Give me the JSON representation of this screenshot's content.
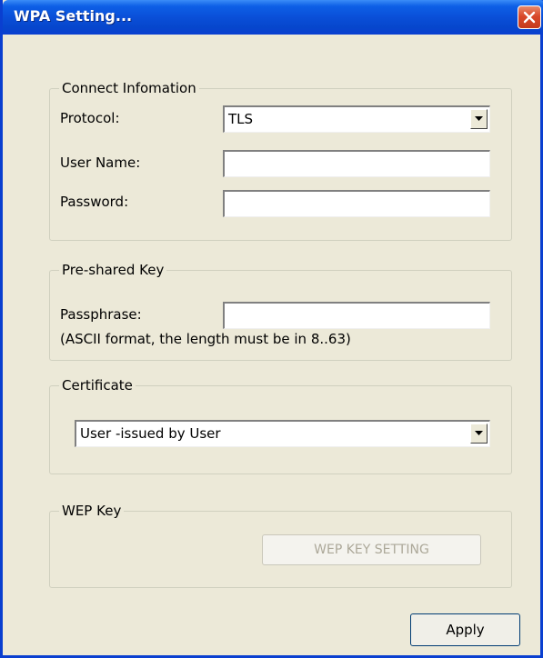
{
  "window": {
    "title": "WPA Setting..."
  },
  "connect": {
    "legend": "Connect Infomation",
    "protocol_label": "Protocol:",
    "protocol_value": "TLS",
    "username_label": "User Name:",
    "username_value": "",
    "password_label": "Password:",
    "password_value": ""
  },
  "preshared": {
    "legend": "Pre-shared Key",
    "passphrase_label": "Passphrase:",
    "passphrase_value": "",
    "hint": "(ASCII format, the length must be in 8..63)"
  },
  "certificate": {
    "legend": "Certificate",
    "selected": "User -issued by User"
  },
  "wep": {
    "legend": "WEP Key",
    "button_label": "WEP KEY SETTING"
  },
  "actions": {
    "apply_label": "Apply"
  },
  "colors": {
    "titlebar": "#0a4fd8",
    "dialog_bg": "#ece9d8",
    "close_button": "#d9482a"
  }
}
